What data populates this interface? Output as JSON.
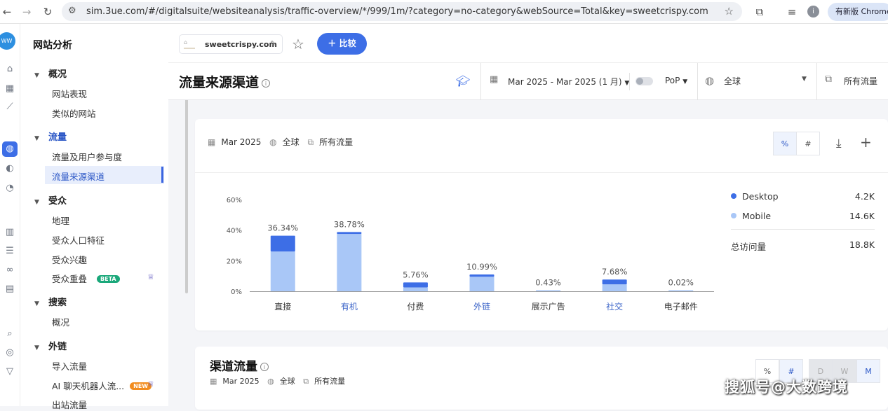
{
  "browser": {
    "url": "sim.3ue.com/#/digitalsuite/websiteanalysis/traffic-overview/*/999/1m/?category=no-category&webSource=Total&key=sweetcrispy.com",
    "chrome_button": "有新版 Chrome",
    "profile_initial": "i"
  },
  "sidebar": {
    "title": "网站分析",
    "sections": [
      {
        "label": "概况",
        "items": [
          "网站表现",
          "类似的网站"
        ]
      },
      {
        "label": "流量",
        "items": [
          "流量及用户参与度",
          "流量来源渠道"
        ]
      },
      {
        "label": "受众",
        "items": [
          "地理",
          "受众人口特征",
          "受众兴趣",
          "受众重叠"
        ]
      },
      {
        "label": "搜索",
        "items": [
          "概况"
        ]
      },
      {
        "label": "外链",
        "items": [
          "导入流量",
          "AI 聊天机器人流...",
          "出站流量"
        ]
      }
    ],
    "active_item": "流量来源渠道",
    "badges": {
      "beta": "BETA",
      "new": "NEW"
    }
  },
  "topbar": {
    "site": "sweetcrispy.com",
    "compare": "比较"
  },
  "header": {
    "title": "流量来源渠道",
    "date_range": "Mar 2025 - Mar 2025 (1 月)",
    "pop": "PoP",
    "region": "全球",
    "traffic": "所有流量"
  },
  "card1": {
    "filters": {
      "date": "Mar 2025",
      "region": "全球",
      "traffic": "所有流量"
    },
    "toggle_pct": "%",
    "toggle_num": "#"
  },
  "chart_data": {
    "type": "bar",
    "stacked": true,
    "categories": [
      "直接",
      "有机",
      "付费",
      "外链",
      "展示广告",
      "社交",
      "电子邮件"
    ],
    "totals_pct": [
      36.34,
      38.78,
      5.76,
      10.99,
      0.43,
      7.68,
      0.02
    ],
    "total_labels": [
      "36.34%",
      "38.78%",
      "5.76%",
      "10.99%",
      "0.43%",
      "7.68%",
      "0.02%"
    ],
    "series": [
      {
        "name": "Mobile",
        "values": [
          26.0,
          37.5,
          2.5,
          9.5,
          0.43,
          4.5,
          0.02
        ]
      },
      {
        "name": "Desktop",
        "values": [
          10.34,
          1.28,
          3.26,
          1.49,
          0.0,
          3.18,
          0.0
        ]
      }
    ],
    "yticks": [
      "0%",
      "20%",
      "40%",
      "60%"
    ],
    "ylim": [
      0,
      60
    ],
    "grid": false,
    "legend": [
      {
        "name": "Desktop",
        "value": "4.2K"
      },
      {
        "name": "Mobile",
        "value": "14.6K"
      }
    ],
    "total_label": "总访问量",
    "total_value": "18.8K"
  },
  "colors": {
    "desktop": "#3d6ee6",
    "mobile": "#a9c7f7",
    "accent": "#3d6ee6"
  },
  "card2": {
    "title": "渠道流量",
    "filters": {
      "date": "Mar 2025",
      "region": "全球",
      "traffic": "所有流量"
    },
    "toggle_pct": "%",
    "toggle_num": "#",
    "granularity": [
      "D",
      "W",
      "M"
    ]
  },
  "watermark": "搜狐号@大数跨境"
}
